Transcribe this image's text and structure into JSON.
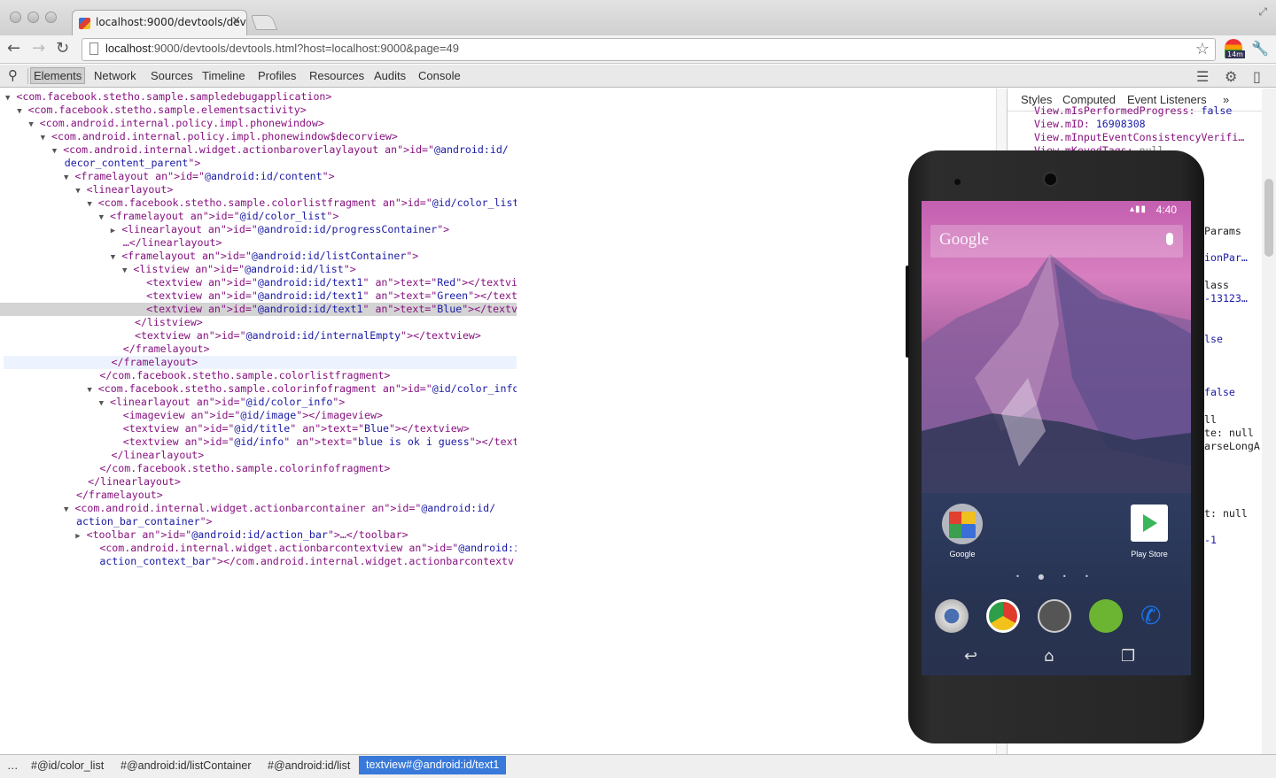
{
  "browser": {
    "tab_title": "localhost:9000/devtools/dev",
    "tab_close": "×",
    "url_host": "localhost",
    "url_rest": ":9000/devtools/devtools.html?host=localhost:9000&page=49",
    "ext_badge": "14m"
  },
  "devtools": {
    "tabs": [
      "Elements",
      "Network",
      "Sources",
      "Timeline",
      "Profiles",
      "Resources",
      "Audits",
      "Console"
    ],
    "selected_tab": "Elements",
    "sidebar_tabs": [
      "Styles",
      "Computed",
      "Event Listeners"
    ],
    "sidebar_more": "»"
  },
  "dom_tree": [
    {
      "indent": 0,
      "tri": "▼",
      "text": "<com.facebook.stetho.sample.sampledebugapplication>"
    },
    {
      "indent": 1,
      "tri": "▼",
      "text": "<com.facebook.stetho.sample.elementsactivity>"
    },
    {
      "indent": 2,
      "tri": "▼",
      "text": "<com.android.internal.policy.impl.phonewindow>"
    },
    {
      "indent": 3,
      "tri": "▼",
      "text": "<com.android.internal.policy.impl.phonewindow$decorview>"
    },
    {
      "indent": 4,
      "tri": "▼",
      "text": "<com.android.internal.widget.actionbaroverlaylayout id=\"@android:id/"
    },
    {
      "indent": 4,
      "tri": "",
      "text": "decor_content_parent\">"
    },
    {
      "indent": 5,
      "tri": "▼",
      "text": "<framelayout id=\"@android:id/content\">"
    },
    {
      "indent": 6,
      "tri": "▼",
      "text": "<linearlayout>"
    },
    {
      "indent": 7,
      "tri": "▼",
      "text": "<com.facebook.stetho.sample.colorlistfragment id=\"@id/color_list\""
    },
    {
      "indent": 8,
      "tri": "▼",
      "text": "<framelayout id=\"@id/color_list\">"
    },
    {
      "indent": 9,
      "tri": "▶",
      "text": "<linearlayout id=\"@android:id/progressContainer\">"
    },
    {
      "indent": 9,
      "tri": "",
      "text": "…</linearlayout>"
    },
    {
      "indent": 9,
      "tri": "▼",
      "text": "<framelayout id=\"@android:id/listContainer\">"
    },
    {
      "indent": 10,
      "tri": "▼",
      "text": "<listview id=\"@android:id/list\">"
    },
    {
      "indent": 11,
      "tri": "",
      "text": "<textview id=\"@android:id/text1\" text=\"Red\"></textview>"
    },
    {
      "indent": 11,
      "tri": "",
      "text": "<textview id=\"@android:id/text1\" text=\"Green\"></textview>"
    },
    {
      "indent": 11,
      "tri": "",
      "text": "<textview id=\"@android:id/text1\" text=\"Blue\"></textview>"
    },
    {
      "indent": 10,
      "tri": "",
      "text": "</listview>"
    },
    {
      "indent": 10,
      "tri": "",
      "text": "<textview id=\"@android:id/internalEmpty\"></textview>"
    },
    {
      "indent": 9,
      "tri": "",
      "text": "</framelayout>"
    },
    {
      "indent": 8,
      "tri": "",
      "text": "</framelayout>"
    },
    {
      "indent": 7,
      "tri": "",
      "text": "</com.facebook.stetho.sample.colorlistfragment>"
    },
    {
      "indent": 7,
      "tri": "▼",
      "text": "<com.facebook.stetho.sample.colorinfofragment id=\"@id/color_info\""
    },
    {
      "indent": 8,
      "tri": "▼",
      "text": "<linearlayout id=\"@id/color_info\">"
    },
    {
      "indent": 9,
      "tri": "",
      "text": "<imageview id=\"@id/image\"></imageview>"
    },
    {
      "indent": 9,
      "tri": "",
      "text": "<textview id=\"@id/title\" text=\"Blue\"></textview>"
    },
    {
      "indent": 9,
      "tri": "",
      "text": "<textview id=\"@id/info\" text=\"blue is ok i guess\"></textview>"
    },
    {
      "indent": 8,
      "tri": "",
      "text": "</linearlayout>"
    },
    {
      "indent": 7,
      "tri": "",
      "text": "</com.facebook.stetho.sample.colorinfofragment>"
    },
    {
      "indent": 6,
      "tri": "",
      "text": "</linearlayout>"
    },
    {
      "indent": 5,
      "tri": "",
      "text": "</framelayout>"
    },
    {
      "indent": 5,
      "tri": "▼",
      "text": "<com.android.internal.widget.actionbarcontainer id=\"@android:id/"
    },
    {
      "indent": 5,
      "tri": "",
      "text": "action_bar_container\">"
    },
    {
      "indent": 6,
      "tri": "▶",
      "text": "<toolbar id=\"@android:id/action_bar\">…</toolbar>"
    },
    {
      "indent": 7,
      "tri": "",
      "text": "<com.android.internal.widget.actionbarcontextview id=\"@android:id/"
    },
    {
      "indent": 7,
      "tri": "",
      "text": "action_context_bar\"></com.android.internal.widget.actionbarcontextv"
    }
  ],
  "sidebar_lines": [
    {
      "key": "View.mIsPerformedProgress:",
      "val": "false"
    },
    {
      "key": "View.mID:",
      "val": "16908308"
    },
    {
      "key": "View.mInputEventConsistencyVerifi…",
      "val": ""
    },
    {
      "key": "View.mKeyedTags:",
      "val": "null"
    }
  ],
  "sidebar_peek": [
    "Params",
    "ionPar…",
    "lass",
    "-13123…",
    "lse",
    "false",
    "ll",
    "te: null",
    "arseLongA",
    "t: null",
    "-1"
  ],
  "breadcrumbs": [
    "…",
    "#@id/color_list",
    "#@android:id/listContainer",
    "#@android:id/list",
    "textview#@android:id/text1"
  ],
  "phone": {
    "time": "4:40",
    "search_text": "Google",
    "apps": [
      "Google",
      "Play Store"
    ]
  },
  "colors": {
    "tag": "#881280",
    "attr_name": "#994500",
    "attr_value": "#1a1aa6",
    "selection": "#3879d9"
  }
}
